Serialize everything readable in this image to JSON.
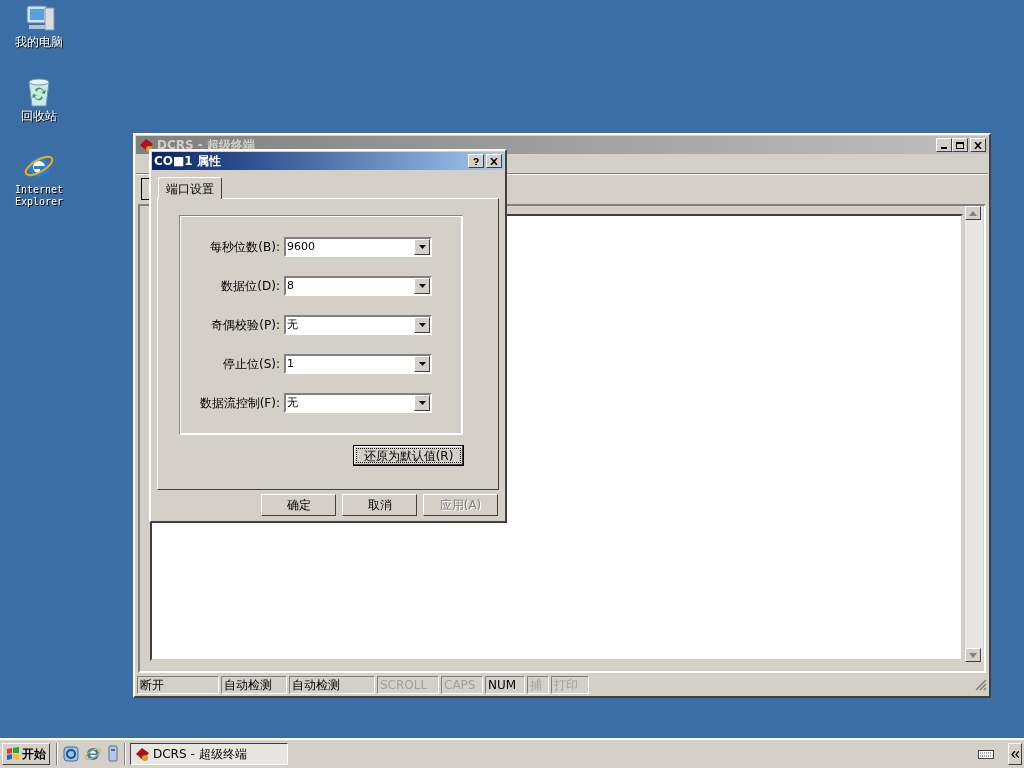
{
  "desktop_icons": [
    {
      "kind": "computer",
      "label": "我的电脑"
    },
    {
      "kind": "recycle",
      "label": "回收站"
    },
    {
      "kind": "browser",
      "label": "Internet Explorer"
    }
  ],
  "main_window": {
    "title": "DCRS - 超级终端",
    "status_bar": [
      {
        "text": "断开",
        "disabled": false
      },
      {
        "text": "自动检测",
        "disabled": false
      },
      {
        "text": "自动检测",
        "disabled": false
      },
      {
        "text": "SCROLL",
        "disabled": true
      },
      {
        "text": "CAPS",
        "disabled": true
      },
      {
        "text": "NUM",
        "disabled": false
      },
      {
        "text": "捕",
        "disabled": true
      },
      {
        "text": "打印",
        "disabled": true
      }
    ]
  },
  "dialog": {
    "title": "CO■1 属性",
    "tabs": [
      {
        "label": "端口设置",
        "selected": true
      }
    ],
    "fields": [
      {
        "label": "每秒位数(B):",
        "value": "9600"
      },
      {
        "label": "数据位(D):",
        "value": "8"
      },
      {
        "label": "奇偶校验(P):",
        "value": "无"
      },
      {
        "label": "停止位(S):",
        "value": "1"
      },
      {
        "label": "数据流控制(F):",
        "value": "无"
      }
    ],
    "reset_button": "还原为默认值(R)",
    "buttons": [
      {
        "label": "确定",
        "disabled": false
      },
      {
        "label": "取消",
        "disabled": false
      },
      {
        "label": "应用(A)",
        "disabled": true
      }
    ]
  },
  "taskbar": {
    "start_label": "开始",
    "tasks": [
      {
        "label": "DCRS - 超级终端",
        "selected": true
      }
    ]
  }
}
